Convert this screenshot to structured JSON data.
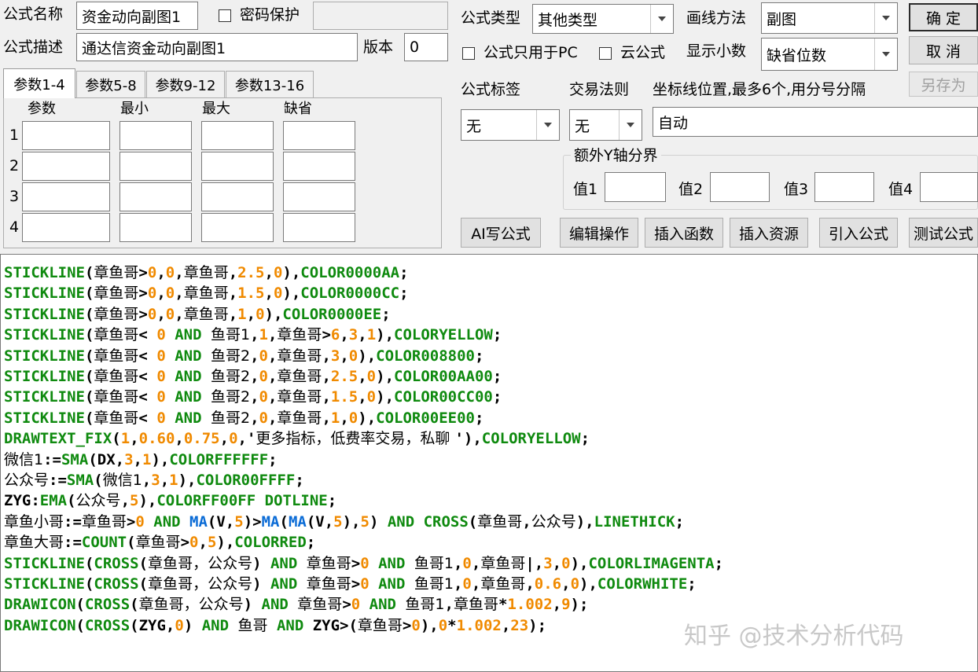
{
  "header": {
    "name_label": "公式名称",
    "name_value": "资金动向副图1",
    "password_label": "密码保护",
    "password_value": "",
    "desc_label": "公式描述",
    "desc_value": "通达信资金动向副图1",
    "version_label": "版本",
    "version_value": "0"
  },
  "tabs": [
    "参数1-4",
    "参数5-8",
    "参数9-12",
    "参数13-16"
  ],
  "params": {
    "col_headers": [
      "参数",
      "最小",
      "最大",
      "缺省"
    ],
    "row_numbers": [
      "1",
      "2",
      "3",
      "4"
    ]
  },
  "options": {
    "type_label": "公式类型",
    "type_value": "其他类型",
    "draw_label": "画线方法",
    "draw_value": "副图",
    "pc_only_label": "公式只用于PC",
    "cloud_label": "云公式",
    "decimal_label": "显示小数",
    "decimal_value": "缺省位数",
    "tag_label": "公式标签",
    "tag_value": "无",
    "rule_label": "交易法则",
    "rule_value": "无",
    "axis_label": "坐标线位置,最多6个,用分号分隔",
    "axis_value": "自动",
    "yaxis_group_label": "额外Y轴分界",
    "val1": "值1",
    "val2": "值2",
    "val3": "值3",
    "val4": "值4"
  },
  "buttons": {
    "ok": "确 定",
    "cancel": "取 消",
    "save_as": "另存为",
    "ai_write": "AI写公式",
    "edit_ops": "编辑操作",
    "insert_func": "插入函数",
    "insert_res": "插入资源",
    "import_formula": "引入公式",
    "test_formula": "测试公式"
  },
  "code_lines": [
    [
      [
        "k",
        "STICKLINE"
      ],
      [
        "p",
        "("
      ],
      [
        "v",
        "章鱼哥"
      ],
      [
        "p",
        ">"
      ],
      [
        "n",
        "0"
      ],
      [
        "p",
        ","
      ],
      [
        "n",
        "0"
      ],
      [
        "p",
        ","
      ],
      [
        "v",
        "章鱼哥"
      ],
      [
        "p",
        ","
      ],
      [
        "n",
        "2.5"
      ],
      [
        "p",
        ","
      ],
      [
        "n",
        "0"
      ],
      [
        "p",
        "),"
      ],
      [
        "k",
        "COLOR0000AA"
      ],
      [
        "p",
        ";"
      ]
    ],
    [
      [
        "k",
        "STICKLINE"
      ],
      [
        "p",
        "("
      ],
      [
        "v",
        "章鱼哥"
      ],
      [
        "p",
        ">"
      ],
      [
        "n",
        "0"
      ],
      [
        "p",
        ","
      ],
      [
        "n",
        "0"
      ],
      [
        "p",
        ","
      ],
      [
        "v",
        "章鱼哥"
      ],
      [
        "p",
        ","
      ],
      [
        "n",
        "1.5"
      ],
      [
        "p",
        ","
      ],
      [
        "n",
        "0"
      ],
      [
        "p",
        "),"
      ],
      [
        "k",
        "COLOR0000CC"
      ],
      [
        "p",
        ";"
      ]
    ],
    [
      [
        "k",
        "STICKLINE"
      ],
      [
        "p",
        "("
      ],
      [
        "v",
        "章鱼哥"
      ],
      [
        "p",
        ">"
      ],
      [
        "n",
        "0"
      ],
      [
        "p",
        ","
      ],
      [
        "n",
        "0"
      ],
      [
        "p",
        ","
      ],
      [
        "v",
        "章鱼哥"
      ],
      [
        "p",
        ","
      ],
      [
        "n",
        "1"
      ],
      [
        "p",
        ","
      ],
      [
        "n",
        "0"
      ],
      [
        "p",
        "),"
      ],
      [
        "k",
        "COLOR0000EE"
      ],
      [
        "p",
        ";"
      ]
    ],
    [
      [
        "k",
        "STICKLINE"
      ],
      [
        "p",
        "("
      ],
      [
        "v",
        "章鱼哥"
      ],
      [
        "p",
        "< "
      ],
      [
        "n",
        "0"
      ],
      [
        "k",
        " AND "
      ],
      [
        "v",
        "鱼哥1"
      ],
      [
        "p",
        ","
      ],
      [
        "n",
        "1"
      ],
      [
        "p",
        ","
      ],
      [
        "v",
        "章鱼哥"
      ],
      [
        "p",
        ">"
      ],
      [
        "n",
        "6"
      ],
      [
        "p",
        ","
      ],
      [
        "n",
        "3"
      ],
      [
        "p",
        ","
      ],
      [
        "n",
        "1"
      ],
      [
        "p",
        "),"
      ],
      [
        "k",
        "COLORYELLOW"
      ],
      [
        "p",
        ";"
      ]
    ],
    [
      [
        "k",
        "STICKLINE"
      ],
      [
        "p",
        "("
      ],
      [
        "v",
        "章鱼哥"
      ],
      [
        "p",
        "< "
      ],
      [
        "n",
        "0"
      ],
      [
        "k",
        " AND "
      ],
      [
        "v",
        "鱼哥2"
      ],
      [
        "p",
        ","
      ],
      [
        "n",
        "0"
      ],
      [
        "p",
        ","
      ],
      [
        "v",
        "章鱼哥"
      ],
      [
        "p",
        ","
      ],
      [
        "n",
        "3"
      ],
      [
        "p",
        ","
      ],
      [
        "n",
        "0"
      ],
      [
        "p",
        "),"
      ],
      [
        "k",
        "COLOR008800"
      ],
      [
        "p",
        ";"
      ]
    ],
    [
      [
        "k",
        "STICKLINE"
      ],
      [
        "p",
        "("
      ],
      [
        "v",
        "章鱼哥"
      ],
      [
        "p",
        "< "
      ],
      [
        "n",
        "0"
      ],
      [
        "k",
        " AND "
      ],
      [
        "v",
        "鱼哥2"
      ],
      [
        "p",
        ","
      ],
      [
        "n",
        "0"
      ],
      [
        "p",
        ","
      ],
      [
        "v",
        "章鱼哥"
      ],
      [
        "p",
        ","
      ],
      [
        "n",
        "2.5"
      ],
      [
        "p",
        ","
      ],
      [
        "n",
        "0"
      ],
      [
        "p",
        "),"
      ],
      [
        "k",
        "COLOR00AA00"
      ],
      [
        "p",
        ";"
      ]
    ],
    [
      [
        "k",
        "STICKLINE"
      ],
      [
        "p",
        "("
      ],
      [
        "v",
        "章鱼哥"
      ],
      [
        "p",
        "< "
      ],
      [
        "n",
        "0"
      ],
      [
        "k",
        " AND "
      ],
      [
        "v",
        "鱼哥2"
      ],
      [
        "p",
        ","
      ],
      [
        "n",
        "0"
      ],
      [
        "p",
        ","
      ],
      [
        "v",
        "章鱼哥"
      ],
      [
        "p",
        ","
      ],
      [
        "n",
        "1.5"
      ],
      [
        "p",
        ","
      ],
      [
        "n",
        "0"
      ],
      [
        "p",
        "),"
      ],
      [
        "k",
        "COLOR00CC00"
      ],
      [
        "p",
        ";"
      ]
    ],
    [
      [
        "k",
        "STICKLINE"
      ],
      [
        "p",
        "("
      ],
      [
        "v",
        "章鱼哥"
      ],
      [
        "p",
        "< "
      ],
      [
        "n",
        "0"
      ],
      [
        "k",
        " AND "
      ],
      [
        "v",
        "鱼哥2"
      ],
      [
        "p",
        ","
      ],
      [
        "n",
        "0"
      ],
      [
        "p",
        ","
      ],
      [
        "v",
        "章鱼哥"
      ],
      [
        "p",
        ","
      ],
      [
        "n",
        "1"
      ],
      [
        "p",
        ","
      ],
      [
        "n",
        "0"
      ],
      [
        "p",
        "),"
      ],
      [
        "k",
        "COLOR00EE00"
      ],
      [
        "p",
        ";"
      ]
    ],
    [
      [
        "k",
        "DRAWTEXT_FIX"
      ],
      [
        "p",
        "("
      ],
      [
        "n",
        "1"
      ],
      [
        "p",
        ","
      ],
      [
        "n",
        "0.60"
      ],
      [
        "p",
        ","
      ],
      [
        "n",
        "0.75"
      ],
      [
        "p",
        ","
      ],
      [
        "n",
        "0"
      ],
      [
        "p",
        ",'"
      ],
      [
        "v",
        "更多指标，低费率交易，私聊 "
      ],
      [
        "p",
        "'),"
      ],
      [
        "k",
        "COLORYELLOW"
      ],
      [
        "p",
        ";"
      ]
    ],
    [
      [
        "v",
        "微信1"
      ],
      [
        "p",
        ":="
      ],
      [
        "k",
        "SMA"
      ],
      [
        "p",
        "(DX,"
      ],
      [
        "n",
        "3"
      ],
      [
        "p",
        ","
      ],
      [
        "n",
        "1"
      ],
      [
        "p",
        "),"
      ],
      [
        "k",
        "COLORFFFFFF"
      ],
      [
        "p",
        ";"
      ]
    ],
    [
      [
        "v",
        "公众号"
      ],
      [
        "p",
        ":="
      ],
      [
        "k",
        "SMA"
      ],
      [
        "p",
        "("
      ],
      [
        "v",
        "微信1"
      ],
      [
        "p",
        ","
      ],
      [
        "n",
        "3"
      ],
      [
        "p",
        ","
      ],
      [
        "n",
        "1"
      ],
      [
        "p",
        "),"
      ],
      [
        "k",
        "COLOR00FFFF"
      ],
      [
        "p",
        ";"
      ]
    ],
    [
      [
        "p",
        "ZYG:"
      ],
      [
        "k",
        "EMA"
      ],
      [
        "p",
        "("
      ],
      [
        "v",
        "公众号"
      ],
      [
        "p",
        ","
      ],
      [
        "n",
        "5"
      ],
      [
        "p",
        "),"
      ],
      [
        "k",
        "COLORFF00FF DOTLINE"
      ],
      [
        "p",
        ";"
      ]
    ],
    [
      [
        "v",
        "章鱼小哥"
      ],
      [
        "p",
        ":="
      ],
      [
        "v",
        "章鱼哥"
      ],
      [
        "p",
        ">"
      ],
      [
        "n",
        "0"
      ],
      [
        "k",
        " AND "
      ],
      [
        "f",
        "MA"
      ],
      [
        "p",
        "(V,"
      ],
      [
        "n",
        "5"
      ],
      [
        "p",
        ")>"
      ],
      [
        "f",
        "MA"
      ],
      [
        "p",
        "("
      ],
      [
        "f",
        "MA"
      ],
      [
        "p",
        "(V,"
      ],
      [
        "n",
        "5"
      ],
      [
        "p",
        "),"
      ],
      [
        "n",
        "5"
      ],
      [
        "p",
        ")"
      ],
      [
        "k",
        " AND CROSS"
      ],
      [
        "p",
        "("
      ],
      [
        "v",
        "章鱼哥"
      ],
      [
        "p",
        ","
      ],
      [
        "v",
        "公众号"
      ],
      [
        "p",
        "),"
      ],
      [
        "k",
        "LINETHICK"
      ],
      [
        "p",
        ";"
      ]
    ],
    [
      [
        "v",
        "章鱼大哥"
      ],
      [
        "p",
        ":="
      ],
      [
        "k",
        "COUNT"
      ],
      [
        "p",
        "("
      ],
      [
        "v",
        "章鱼哥"
      ],
      [
        "p",
        ">"
      ],
      [
        "n",
        "0"
      ],
      [
        "p",
        ","
      ],
      [
        "n",
        "5"
      ],
      [
        "p",
        "),"
      ],
      [
        "k",
        "COLORRED"
      ],
      [
        "p",
        ";"
      ]
    ],
    [
      [
        "k",
        "STICKLINE"
      ],
      [
        "p",
        "("
      ],
      [
        "k",
        "CROSS"
      ],
      [
        "p",
        "("
      ],
      [
        "v",
        "章鱼哥，公众号"
      ],
      [
        "p",
        ")"
      ],
      [
        "k",
        " AND "
      ],
      [
        "v",
        "章鱼哥"
      ],
      [
        "p",
        ">"
      ],
      [
        "n",
        "0"
      ],
      [
        "k",
        " AND "
      ],
      [
        "v",
        "鱼哥1"
      ],
      [
        "p",
        ","
      ],
      [
        "n",
        "0"
      ],
      [
        "p",
        ","
      ],
      [
        "v",
        "章鱼哥"
      ],
      [
        "p",
        "|,"
      ],
      [
        "n",
        "3"
      ],
      [
        "p",
        ","
      ],
      [
        "n",
        "0"
      ],
      [
        "p",
        "),"
      ],
      [
        "k",
        "COLORLIMAGENTA"
      ],
      [
        "p",
        ";"
      ]
    ],
    [
      [
        "k",
        "STICKLINE"
      ],
      [
        "p",
        "("
      ],
      [
        "k",
        "CROSS"
      ],
      [
        "p",
        "("
      ],
      [
        "v",
        "章鱼哥，公众号"
      ],
      [
        "p",
        ")"
      ],
      [
        "k",
        " AND "
      ],
      [
        "v",
        "章鱼哥"
      ],
      [
        "p",
        ">"
      ],
      [
        "n",
        "0"
      ],
      [
        "k",
        " AND "
      ],
      [
        "v",
        "鱼哥1"
      ],
      [
        "p",
        ","
      ],
      [
        "n",
        "0"
      ],
      [
        "p",
        ","
      ],
      [
        "v",
        "章鱼哥"
      ],
      [
        "p",
        ","
      ],
      [
        "n",
        "0.6"
      ],
      [
        "p",
        ","
      ],
      [
        "n",
        "0"
      ],
      [
        "p",
        "),"
      ],
      [
        "k",
        "COLORWHITE"
      ],
      [
        "p",
        ";"
      ]
    ],
    [
      [
        "k",
        "DRAWICON"
      ],
      [
        "p",
        "("
      ],
      [
        "k",
        "CROSS"
      ],
      [
        "p",
        "("
      ],
      [
        "v",
        "章鱼哥，公众号"
      ],
      [
        "p",
        ")"
      ],
      [
        "k",
        " AND "
      ],
      [
        "v",
        "章鱼哥"
      ],
      [
        "p",
        ">"
      ],
      [
        "n",
        "0"
      ],
      [
        "k",
        " AND "
      ],
      [
        "v",
        "鱼哥1"
      ],
      [
        "p",
        ","
      ],
      [
        "v",
        "章鱼哥"
      ],
      [
        "p",
        "*"
      ],
      [
        "n",
        "1.002"
      ],
      [
        "p",
        ","
      ],
      [
        "n",
        "9"
      ],
      [
        "p",
        ");"
      ]
    ],
    [
      [
        "k",
        "DRAWICON"
      ],
      [
        "p",
        "("
      ],
      [
        "k",
        "CROSS"
      ],
      [
        "p",
        "(ZYG,"
      ],
      [
        "n",
        "0"
      ],
      [
        "p",
        ")"
      ],
      [
        "k",
        " AND "
      ],
      [
        "v",
        "鱼哥"
      ],
      [
        "k",
        " AND "
      ],
      [
        "p",
        "ZYG>("
      ],
      [
        "v",
        "章鱼哥"
      ],
      [
        "p",
        ">"
      ],
      [
        "n",
        "0"
      ],
      [
        "p",
        "),"
      ],
      [
        "n",
        "0"
      ],
      [
        "p",
        "*"
      ],
      [
        "n",
        "1.002"
      ],
      [
        "p",
        ","
      ],
      [
        "n",
        "23"
      ],
      [
        "p",
        ");"
      ]
    ]
  ],
  "watermark": "知乎 @技术分析代码",
  "syntax_colors": {
    "keyword": "#0f8a0f",
    "function": "#0a6bd6",
    "number": "#f08a00",
    "punct": "#000000"
  }
}
